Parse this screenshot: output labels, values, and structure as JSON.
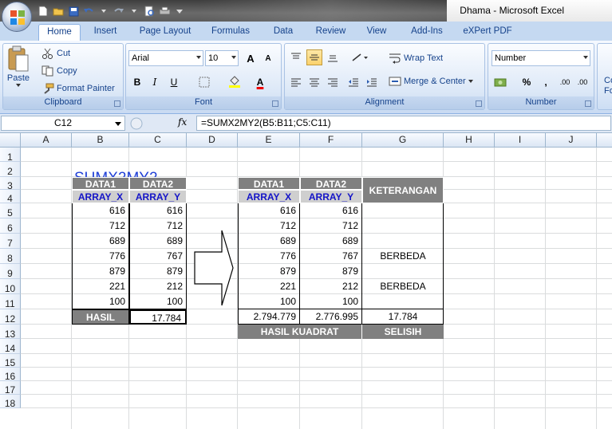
{
  "window": {
    "doc_name": "Dhama",
    "separator": " - ",
    "app_name": "Microsoft Excel"
  },
  "ribbon": {
    "tabs": [
      "Home",
      "Insert",
      "Page Layout",
      "Formulas",
      "Data",
      "Review",
      "View",
      "Add-Ins",
      "eXPert PDF"
    ],
    "active_tab": "Home",
    "clipboard": {
      "paste": "Paste",
      "cut": "Cut",
      "copy": "Copy",
      "format_painter": "Format Painter",
      "group": "Clipboard"
    },
    "font": {
      "name": "Arial",
      "size": "10",
      "bold": "B",
      "italic": "I",
      "underline": "U",
      "font_color_letter": "A",
      "grow": "A",
      "shrink": "A",
      "group": "Font"
    },
    "alignment": {
      "wrap_text": "Wrap Text",
      "merge_center": "Merge & Center",
      "group": "Alignment"
    },
    "number": {
      "format": "Number",
      "percent": "%",
      "comma": ",",
      "inc_decimal": ".00",
      "dec_decimal": ".00",
      "group": "Number"
    },
    "styles_partial": [
      "Co",
      "Fo"
    ]
  },
  "formula_bar": {
    "name_box": "C12",
    "fx": "fx",
    "formula": "=SUMX2MY2(B5:B11;C5:C11)"
  },
  "grid": {
    "columns": [
      "A",
      "B",
      "C",
      "D",
      "E",
      "F",
      "G",
      "H",
      "I",
      "J"
    ],
    "rows": [
      "1",
      "2",
      "3",
      "4",
      "5",
      "6",
      "7",
      "8",
      "9",
      "10",
      "11",
      "12",
      "13",
      "14",
      "15",
      "16",
      "17",
      "18"
    ]
  },
  "sheet": {
    "title": "SUMX2MY2",
    "left_table": {
      "headers1": [
        "DATA1",
        "DATA2"
      ],
      "headers2": [
        "ARRAY_X",
        "ARRAY_Y"
      ],
      "rows": [
        [
          "616",
          "616"
        ],
        [
          "712",
          "712"
        ],
        [
          "689",
          "689"
        ],
        [
          "776",
          "767"
        ],
        [
          "879",
          "879"
        ],
        [
          "221",
          "212"
        ],
        [
          "100",
          "100"
        ]
      ],
      "result_label": "HASIL",
      "result_value": "17.784"
    },
    "right_table": {
      "headers1": [
        "DATA1",
        "DATA2"
      ],
      "headers2": [
        "ARRAY_X",
        "ARRAY_Y"
      ],
      "notes_header": "KETERANGAN",
      "rows": [
        [
          "616",
          "616",
          ""
        ],
        [
          "712",
          "712",
          ""
        ],
        [
          "689",
          "689",
          ""
        ],
        [
          "776",
          "767",
          "BERBEDA"
        ],
        [
          "879",
          "879",
          ""
        ],
        [
          "221",
          "212",
          "BERBEDA"
        ],
        [
          "100",
          "100",
          ""
        ]
      ],
      "totals": [
        "2.794.779",
        "2.776.995",
        "17.784"
      ],
      "footer_left": "HASIL KUADRAT",
      "footer_right": "SELISIH"
    }
  },
  "colors": {
    "title": "#1f3fd6",
    "header_dark": "#808080",
    "header_light": "#cfcfcf",
    "array_text": "#1414c8"
  }
}
